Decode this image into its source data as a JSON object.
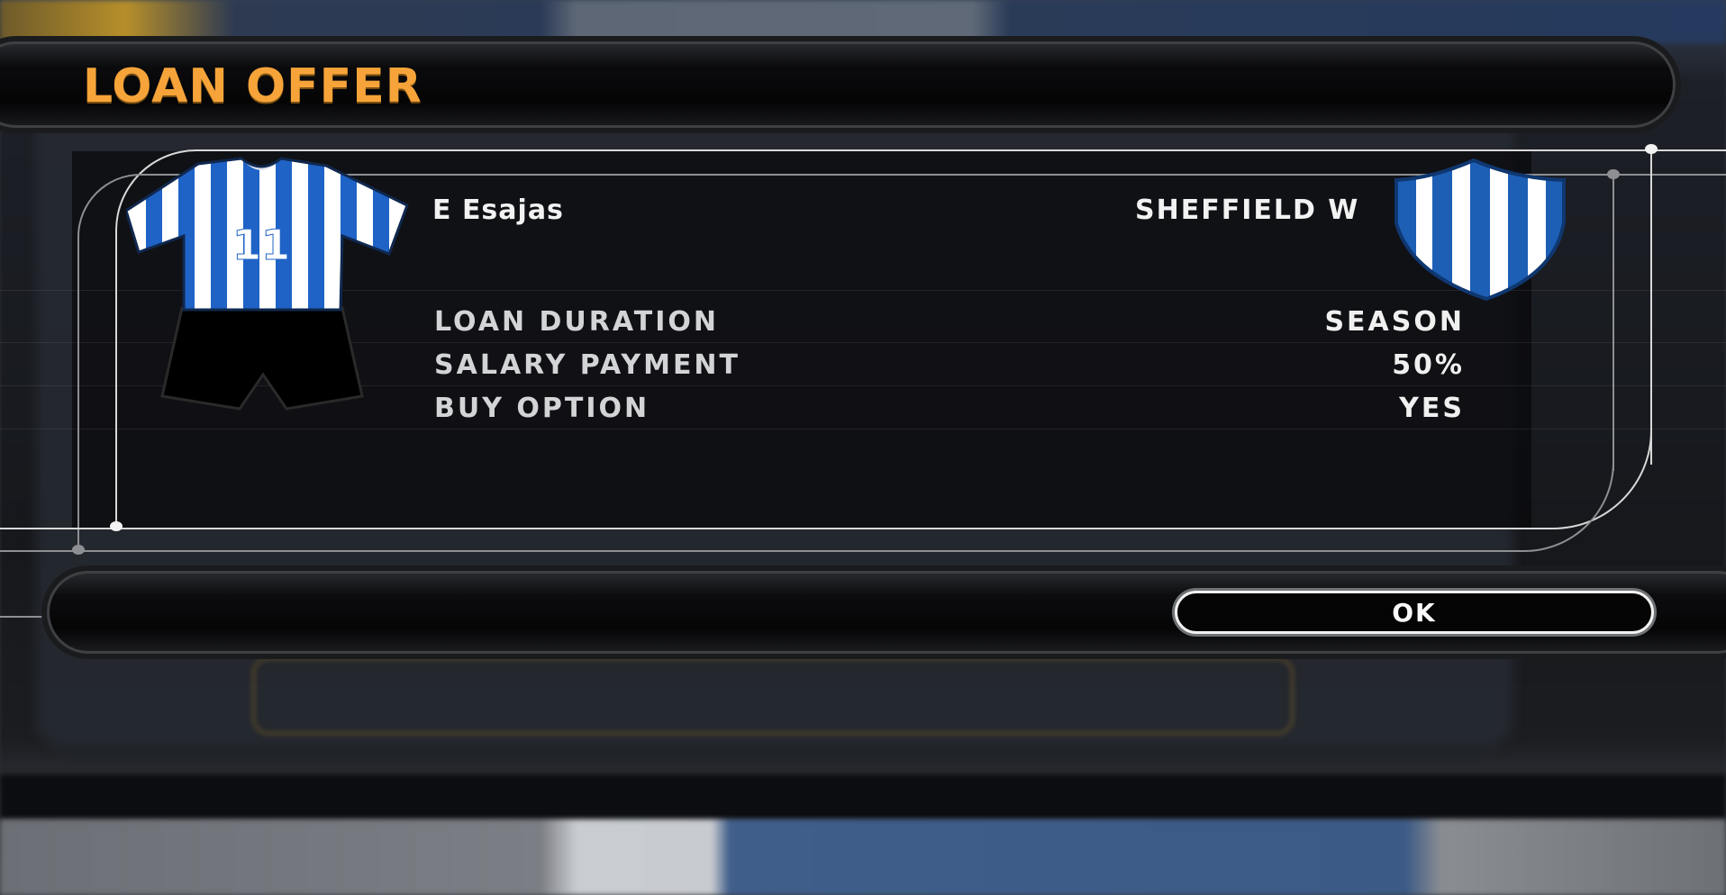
{
  "dialog": {
    "title": "LOAN OFFER"
  },
  "player": {
    "name": "E Esajas",
    "shirt_number": "11",
    "kit_colors": {
      "stripe_primary": "#1f63c6",
      "stripe_secondary": "#ffffff",
      "shorts": "#000000"
    }
  },
  "club": {
    "name": "SHEFFIELD  W",
    "crest_colors": {
      "primary": "#1d5fb5",
      "secondary": "#ffffff"
    }
  },
  "details": [
    {
      "label": "LOAN DURATION",
      "value": "SEASON"
    },
    {
      "label": "SALARY PAYMENT",
      "value": "50%"
    },
    {
      "label": "BUY OPTION",
      "value": "YES"
    }
  ],
  "footer": {
    "ok_label": "OK"
  },
  "colors": {
    "title_accent": "#f6a43a",
    "frame_line": "#d8d8d8"
  }
}
